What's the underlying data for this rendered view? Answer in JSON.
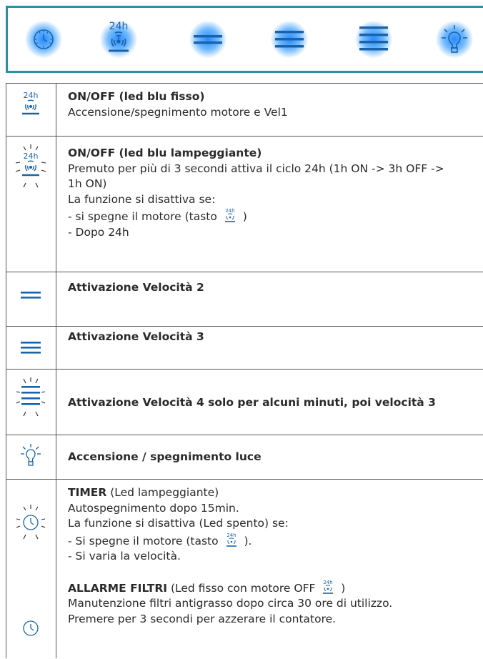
{
  "panel": {
    "buttons": [
      {
        "name": "timer",
        "icon": "clock-icon"
      },
      {
        "name": "fan-24h",
        "icon": "fan-24h-icon",
        "label": "24h"
      },
      {
        "name": "speed-2",
        "icon": "two-bars-icon"
      },
      {
        "name": "speed-3",
        "icon": "three-bars-icon"
      },
      {
        "name": "speed-4",
        "icon": "four-bars-icon"
      },
      {
        "name": "light",
        "icon": "lightbulb-icon"
      }
    ],
    "accent": "#2f8fa0",
    "glow": "#1a7fff",
    "icon_color": "#1b63a8"
  },
  "rows": {
    "r1": {
      "icon_label": "24h",
      "title": "ON/OFF (led blu fisso)",
      "desc": "Accensione/spegnimento motore e Vel1"
    },
    "r2": {
      "icon_label": "24h",
      "title": "ON/OFF (led blu lampeggiante)",
      "l1": "Premuto per più di 3 secondi attiva il ciclo 24h (1h ON -> 3h OFF ->",
      "l2": "1h ON)",
      "l3": "La funzione si disattiva se:",
      "l4a": "- si spegne il motore (tasto",
      "l4b": ")",
      "l5": "- Dopo 24h"
    },
    "r3": {
      "title": "Attivazione Velocità 2"
    },
    "r4": {
      "title": "Attivazione Velocità 3"
    },
    "r5": {
      "title": "Attivazione Velocità 4 solo per alcuni minuti, poi velocità 3"
    },
    "r6": {
      "title": "Accensione / spegnimento luce"
    },
    "r7": {
      "title": "TIMER",
      "title_note": " (Led lampeggiante)",
      "l1": "Autospegnimento dopo 15min.",
      "l2": "La funzione si disattiva (Led spento) se:",
      "l3a": "- Si spegne il motore (tasto",
      "l3b": ").",
      "l4": "- Si varia la velocità.",
      "alarm_title": "ALLARME FILTRI",
      "alarm_note_a": " (Led fisso con motore OFF",
      "alarm_note_b": ")",
      "alarm_l1": "Manutenzione filtri antigrasso dopo circa 30 ore di utilizzo.",
      "alarm_l2": "Premere per 3 secondi per azzerare il contatore."
    },
    "small_icon_label": "24h"
  }
}
